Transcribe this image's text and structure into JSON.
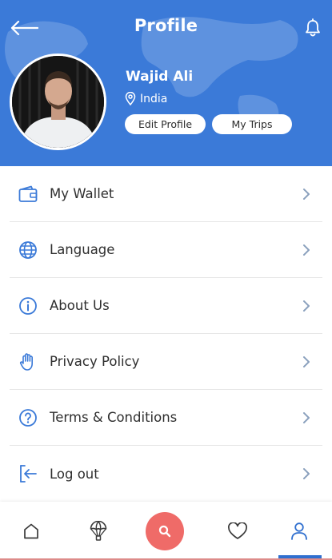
{
  "header": {
    "title": "Profile",
    "background_color": "#3b7ad8"
  },
  "user": {
    "name": "Wajid Ali",
    "location": "India",
    "edit_profile_label": "Edit Profile",
    "my_trips_label": "My Trips"
  },
  "menu": {
    "items": [
      {
        "label": "My Wallet",
        "icon": "wallet-icon"
      },
      {
        "label": "Language",
        "icon": "globe-icon"
      },
      {
        "label": "About Us",
        "icon": "info-icon"
      },
      {
        "label": "Privacy Policy",
        "icon": "hand-icon"
      },
      {
        "label": "Terms & Conditions",
        "icon": "question-icon"
      },
      {
        "label": "Log out",
        "icon": "logout-icon"
      }
    ]
  },
  "bottom_nav": {
    "items": [
      "home-icon",
      "balloon-icon",
      "search-icon",
      "heart-icon",
      "user-icon"
    ],
    "active": "user-icon",
    "accent_color": "#2f6fcf",
    "search_color": "#ef6b68"
  }
}
